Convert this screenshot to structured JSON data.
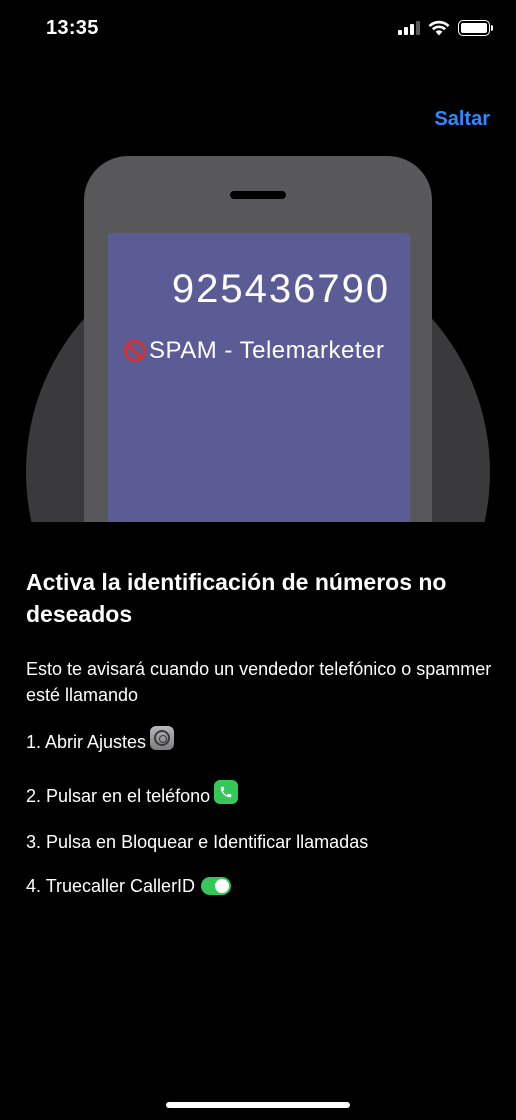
{
  "status_bar": {
    "time": "13:35"
  },
  "header": {
    "skip_label": "Saltar"
  },
  "illustration": {
    "caller_number": "925436790",
    "caller_label": "SPAM - Telemarketer"
  },
  "content": {
    "title": "Activa la identificación de números no deseados",
    "description": "Esto te avisará cuando un vendedor telefónico o spammer esté llamando",
    "steps": [
      {
        "label": "1. Abrir Ajustes",
        "icon": "settings-icon"
      },
      {
        "label": "2. Pulsar en el teléfono",
        "icon": "phone-icon"
      },
      {
        "label": "3. Pulsa en Bloquear e Identificar llamadas",
        "icon": ""
      },
      {
        "label": "4. Truecaller CallerID",
        "icon": "toggle-on-icon"
      }
    ]
  },
  "colors": {
    "accent": "#2e8bff",
    "background": "#000000",
    "toggle_on": "#34c759",
    "phone_screen": "#5b5c96",
    "spam_icon": "#d3322e"
  }
}
